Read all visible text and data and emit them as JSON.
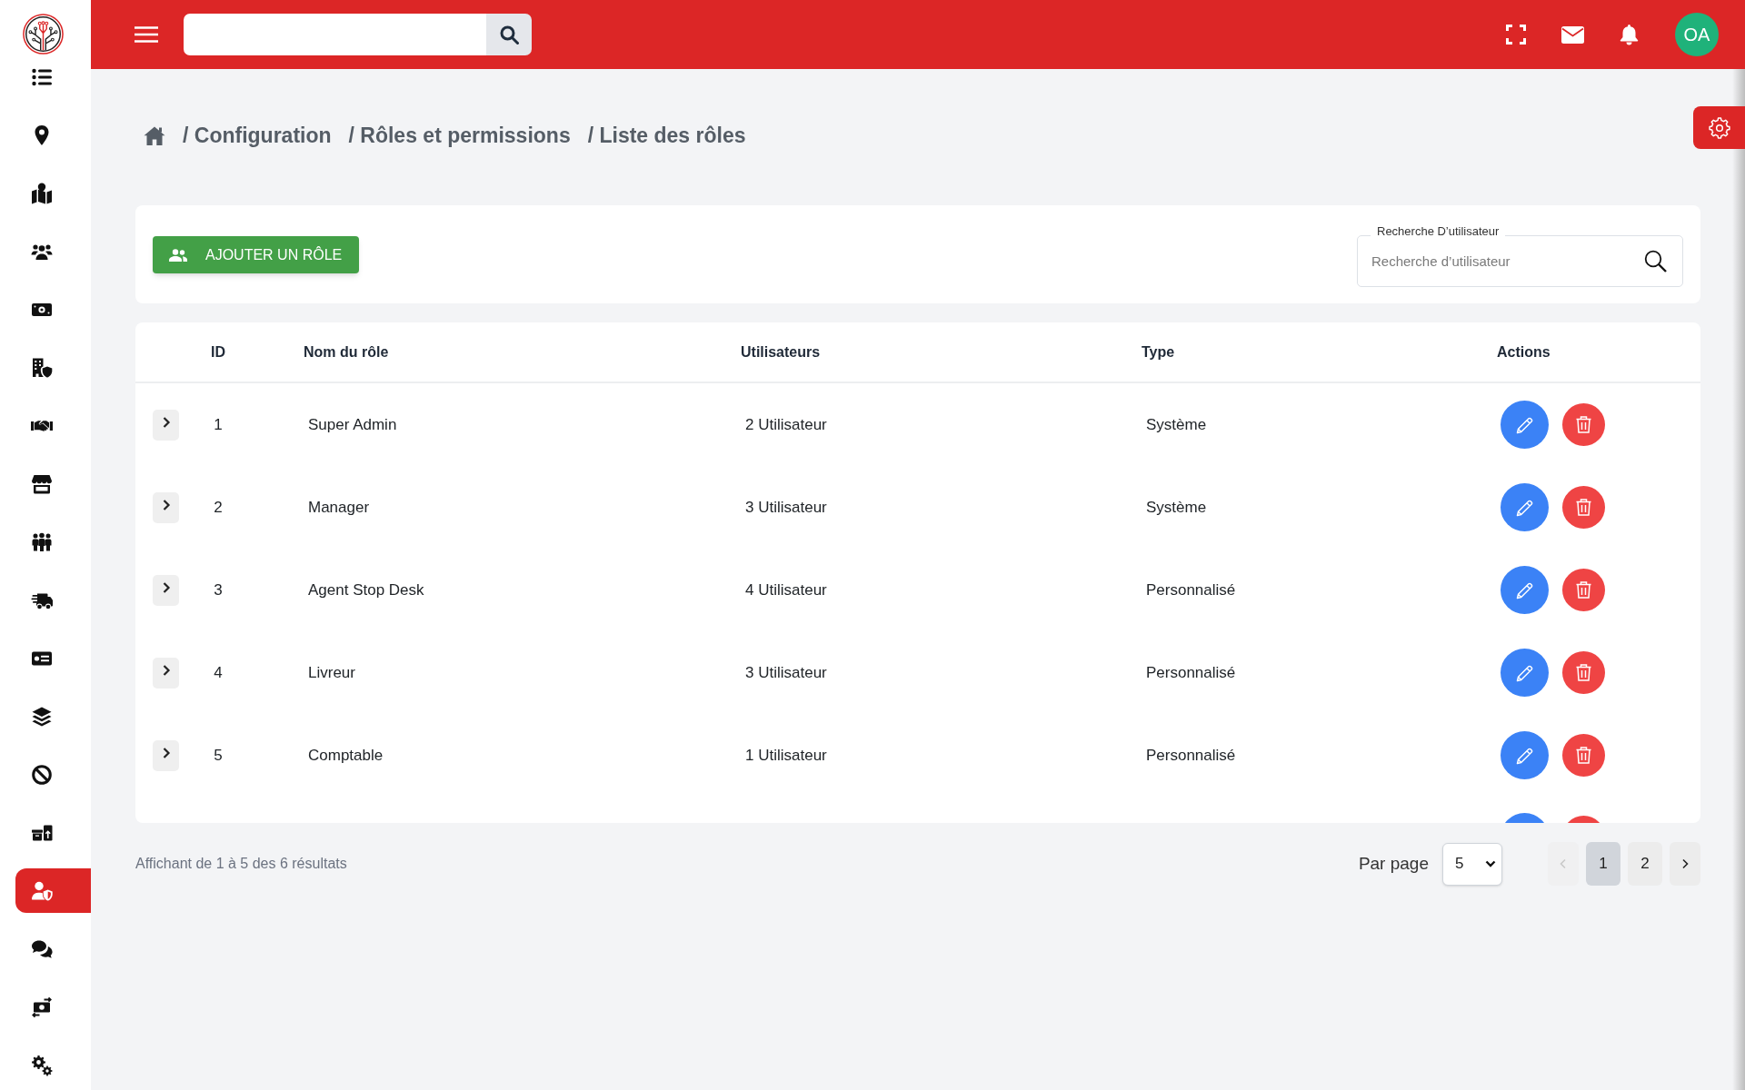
{
  "sidebar": {
    "items": [
      {
        "selected": false
      },
      {
        "selected": false
      },
      {
        "selected": false
      },
      {
        "selected": false
      },
      {
        "selected": false
      },
      {
        "selected": false
      },
      {
        "selected": false
      },
      {
        "selected": false
      },
      {
        "selected": false
      },
      {
        "selected": false
      },
      {
        "selected": false
      },
      {
        "selected": false
      },
      {
        "selected": false
      },
      {
        "selected": false
      },
      {
        "selected": true
      },
      {
        "selected": false
      },
      {
        "selected": false
      },
      {
        "selected": false
      }
    ]
  },
  "topbar": {
    "avatar": {
      "initials": "OA"
    }
  },
  "breadcrumb": {
    "items": [
      {
        "label": "/ Configuration"
      },
      {
        "label": "/ Rôles et permissions"
      },
      {
        "label": "/ Liste des rôles"
      }
    ]
  },
  "toolbar": {
    "add_button": {
      "label": "AJOUTER UN RÔLE"
    },
    "search": {
      "label": "Recherche D’utilisateur",
      "placeholder": "Recherche d’utilisateur"
    }
  },
  "table": {
    "columns": [
      "ID",
      "Nom du rôle",
      "Utilisateurs",
      "Type",
      "Actions"
    ],
    "rows": [
      {
        "id": "1",
        "name": "Super Admin",
        "users": "2 Utilisateur",
        "type": "Système",
        "expanded": false
      },
      {
        "id": "2",
        "name": "Manager",
        "users": "3 Utilisateur",
        "type": "Système",
        "expanded": false
      },
      {
        "id": "3",
        "name": "Agent Stop Desk",
        "users": "4 Utilisateur",
        "type": "Personnalisé",
        "expanded": false
      },
      {
        "id": "4",
        "name": "Livreur",
        "users": "3 Utilisateur",
        "type": "Personnalisé",
        "expanded": false
      },
      {
        "id": "5",
        "name": "Comptable",
        "users": "1 Utilisateur",
        "type": "Personnalisé",
        "expanded": false
      }
    ],
    "more_rows_below": true
  },
  "footer": {
    "summary": "Affichant de 1 à 5 des 6 résultats",
    "per_page": {
      "label": "Par page",
      "value": "5"
    },
    "pagination": {
      "prev": {
        "disabled": true
      },
      "pages": [
        {
          "label": "1",
          "selected": true
        },
        {
          "label": "2",
          "selected": false
        }
      ],
      "next": {
        "disabled": false
      }
    }
  }
}
